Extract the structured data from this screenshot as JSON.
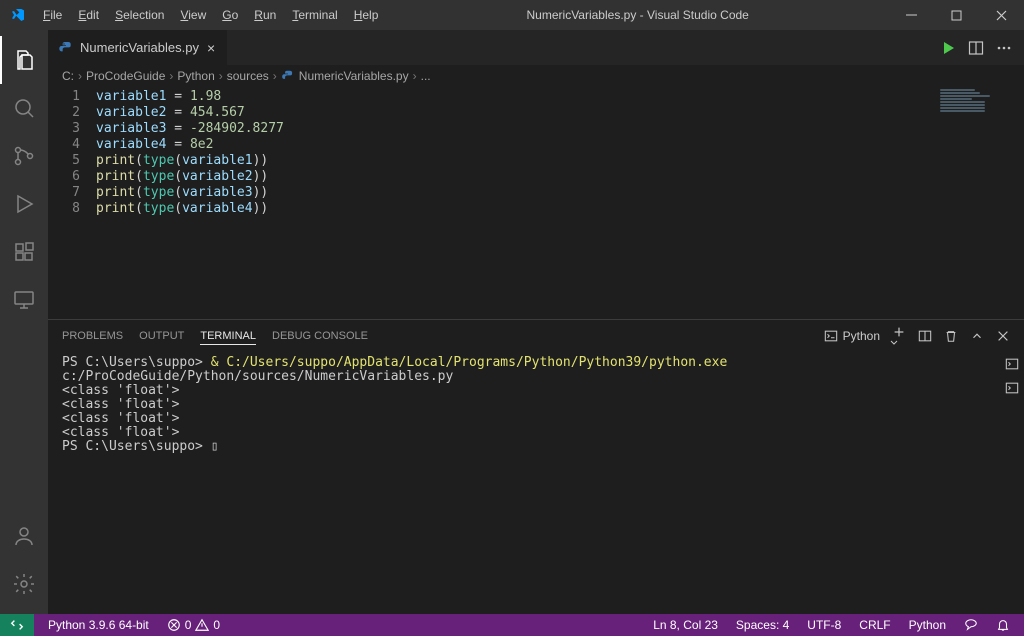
{
  "window": {
    "title": "NumericVariables.py - Visual Studio Code"
  },
  "menu": [
    "File",
    "Edit",
    "Selection",
    "View",
    "Go",
    "Run",
    "Terminal",
    "Help"
  ],
  "tab": {
    "label": "NumericVariables.py"
  },
  "breadcrumbs": [
    "C:",
    "ProCodeGuide",
    "Python",
    "sources",
    "NumericVariables.py",
    "..."
  ],
  "code_lines": [
    [
      [
        "v",
        "variable1"
      ],
      [
        "o",
        " = "
      ],
      [
        "n",
        "1.98"
      ]
    ],
    [
      [
        "v",
        "variable2"
      ],
      [
        "o",
        " = "
      ],
      [
        "n",
        "454.567"
      ]
    ],
    [
      [
        "v",
        "variable3"
      ],
      [
        "o",
        " = "
      ],
      [
        "n",
        "-284902.8277"
      ]
    ],
    [
      [
        "v",
        "variable4"
      ],
      [
        "o",
        " = "
      ],
      [
        "n",
        "8e2"
      ]
    ],
    [
      [
        "f",
        "print"
      ],
      [
        "o",
        "("
      ],
      [
        "b",
        "type"
      ],
      [
        "o",
        "("
      ],
      [
        "v",
        "variable1"
      ],
      [
        "o",
        "))"
      ]
    ],
    [
      [
        "f",
        "print"
      ],
      [
        "o",
        "("
      ],
      [
        "b",
        "type"
      ],
      [
        "o",
        "("
      ],
      [
        "v",
        "variable2"
      ],
      [
        "o",
        "))"
      ]
    ],
    [
      [
        "f",
        "print"
      ],
      [
        "o",
        "("
      ],
      [
        "b",
        "type"
      ],
      [
        "o",
        "("
      ],
      [
        "v",
        "variable3"
      ],
      [
        "o",
        "))"
      ]
    ],
    [
      [
        "f",
        "print"
      ],
      [
        "o",
        "("
      ],
      [
        "b",
        "type"
      ],
      [
        "o",
        "("
      ],
      [
        "v",
        "variable4"
      ],
      [
        "o",
        "))"
      ]
    ]
  ],
  "panel_tabs": {
    "problems": "PROBLEMS",
    "output": "OUTPUT",
    "terminal": "TERMINAL",
    "debug": "DEBUG CONSOLE"
  },
  "terminal": {
    "shell_label": "Python",
    "lines": [
      {
        "prompt": "PS C:\\Users\\suppo> ",
        "cmd": "& C:/Users/suppo/AppData/Local/Programs/Python/Python39/python.exe",
        "arg": " c:/ProCodeGuide/Python/sources/NumericVariables.py"
      },
      {
        "out": "<class 'float'>"
      },
      {
        "out": "<class 'float'>"
      },
      {
        "out": "<class 'float'>"
      },
      {
        "out": "<class 'float'>"
      },
      {
        "prompt": "PS C:\\Users\\suppo> ",
        "cursor": true
      }
    ]
  },
  "status": {
    "python": "Python 3.9.6 64-bit",
    "errors": "0",
    "warnings": "0",
    "lncol": "Ln 8, Col 23",
    "spaces": "Spaces: 4",
    "encoding": "UTF-8",
    "eol": "CRLF",
    "lang": "Python"
  }
}
